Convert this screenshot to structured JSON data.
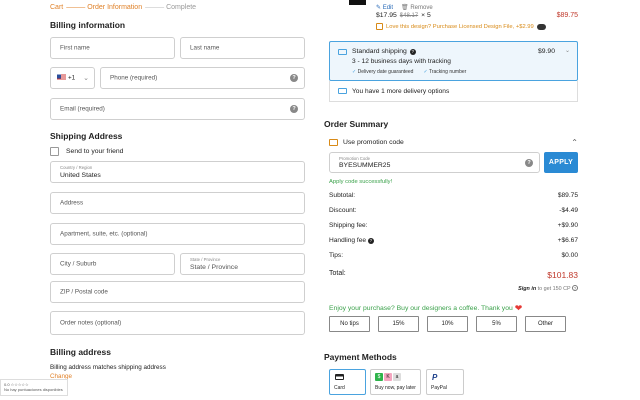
{
  "breadcrumb": {
    "cart": "Cart",
    "order_information": "Order Information",
    "complete": "Complete"
  },
  "billing": {
    "title": "Billing information",
    "first_name_placeholder": "First name",
    "last_name_placeholder": "Last name",
    "country_code": "+1",
    "phone_placeholder": "Phone (required)",
    "email_placeholder": "Email (required)"
  },
  "shipping": {
    "title": "Shipping Address",
    "send_to_friend": "Send to your friend",
    "country_label": "Country / Region",
    "country_value": "United States",
    "address_placeholder": "Address",
    "apartment_placeholder": "Apartment, suite, etc. (optional)",
    "city_placeholder": "City / Suburb",
    "state_label": "State / Province",
    "state_placeholder": "State / Province",
    "zip_placeholder": "ZIP / Postal code",
    "notes_placeholder": "Order notes (optional)"
  },
  "billing_address": {
    "title": "Billing address",
    "matches": "Billing address matches shipping address",
    "change": "Change"
  },
  "cart_item": {
    "edit": "Edit",
    "remove": "Remove",
    "price": "$17.95",
    "old_price": "$48.17",
    "qty": "× 5",
    "line_total": "$89.75",
    "upsell": "Love this design? Purchase Licensed Design File, +$2.99"
  },
  "shipping_method": {
    "name": "Standard shipping",
    "price": "$9.90",
    "eta": "3 - 12 business days with tracking",
    "feature_1": "Delivery date guaranteed",
    "feature_2": "Tracking number",
    "more_options": "You have 1 more delivery options"
  },
  "summary": {
    "title": "Order Summary",
    "use_promo": "Use promotion code",
    "promo_label": "Promotion Code",
    "promo_value": "BYESUMMER25",
    "apply": "APPLY",
    "promo_success": "Apply code successfully!",
    "subtotal_label": "Subtotal:",
    "subtotal": "$89.75",
    "discount_label": "Discount:",
    "discount": "-$4.49",
    "shipping_fee_label": "Shipping fee:",
    "shipping_fee": "+$9.90",
    "handling_fee_label": "Handling fee",
    "handling_fee": "+$6.67",
    "tips_label": "Tips:",
    "tips": "$0.00",
    "total_label": "Total:",
    "total": "$101.83",
    "signin": "Sign in",
    "signin_suffix": "to get 150 CP",
    "enjoy": "Enjoy your purchase? Buy our designers a coffee. Thank you",
    "tip_options": [
      "No tips",
      "15%",
      "10%",
      "5%",
      "Other"
    ]
  },
  "payment": {
    "title": "Payment Methods",
    "card": "Card",
    "bnpl": "Buy now, pay later",
    "paypal": "PayPal",
    "paypal_logo": "P"
  },
  "overlay": {
    "line1": "0.0 ☆☆☆☆☆",
    "line2": "No hay puntuaciones disponibles"
  },
  "colors": {
    "accent": "#e0822a",
    "primary": "#2a8ad4",
    "success": "#3aa14a",
    "price": "#c0392b"
  }
}
